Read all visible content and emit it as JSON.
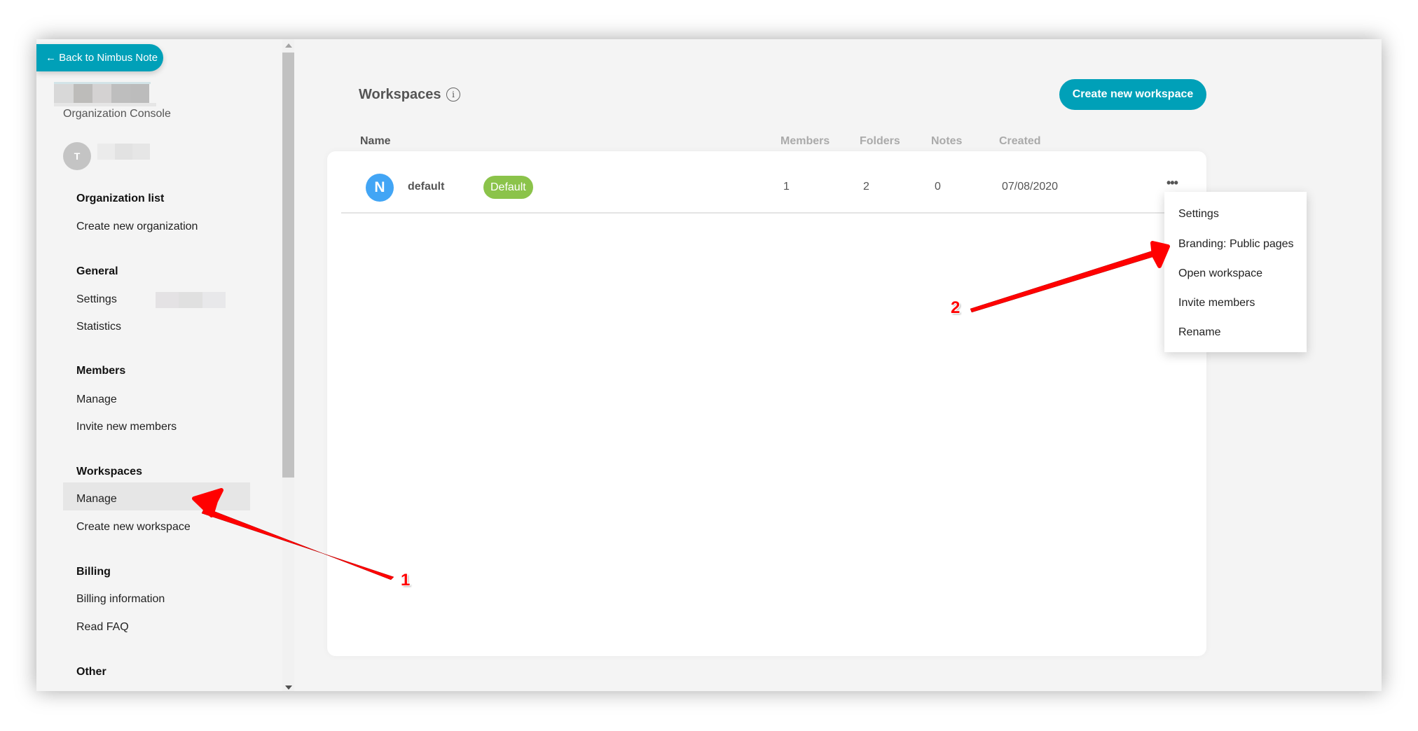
{
  "sidebar": {
    "back_button": "← Back to Nimbus Note",
    "org_console_label": "Organization Console",
    "user_initial": "T",
    "sections": [
      {
        "heading": "Organization list",
        "items": [
          "Create new organization"
        ]
      },
      {
        "heading": "General",
        "items": [
          "Settings",
          "Statistics"
        ]
      },
      {
        "heading": "Members",
        "items": [
          "Manage",
          "Invite new members"
        ]
      },
      {
        "heading": "Workspaces",
        "items": [
          "Manage",
          "Create new workspace"
        ]
      },
      {
        "heading": "Billing",
        "items": [
          "Billing information",
          "Read FAQ"
        ]
      },
      {
        "heading": "Other",
        "items": []
      }
    ],
    "active_item": "Workspaces / Manage"
  },
  "main": {
    "title": "Workspaces",
    "info_icon": "i",
    "create_button": "Create new workspace",
    "columns": [
      "Name",
      "Members",
      "Folders",
      "Notes",
      "Created"
    ],
    "rows": [
      {
        "avatar_letter": "N",
        "name": "default",
        "badge": "Default",
        "members": "1",
        "folders": "2",
        "notes": "0",
        "created": "07/08/2020",
        "more_icon": "•••"
      }
    ],
    "context_menu": [
      "Settings",
      "Branding: Public pages",
      "Open workspace",
      "Invite members",
      "Rename"
    ]
  },
  "annotations": {
    "label_1": "1",
    "label_2": "2"
  },
  "colors": {
    "accent": "#00a0b8",
    "badge_green": "#8bc34a",
    "avatar_blue": "#42a5f5",
    "annotation_red": "#ff0000"
  }
}
